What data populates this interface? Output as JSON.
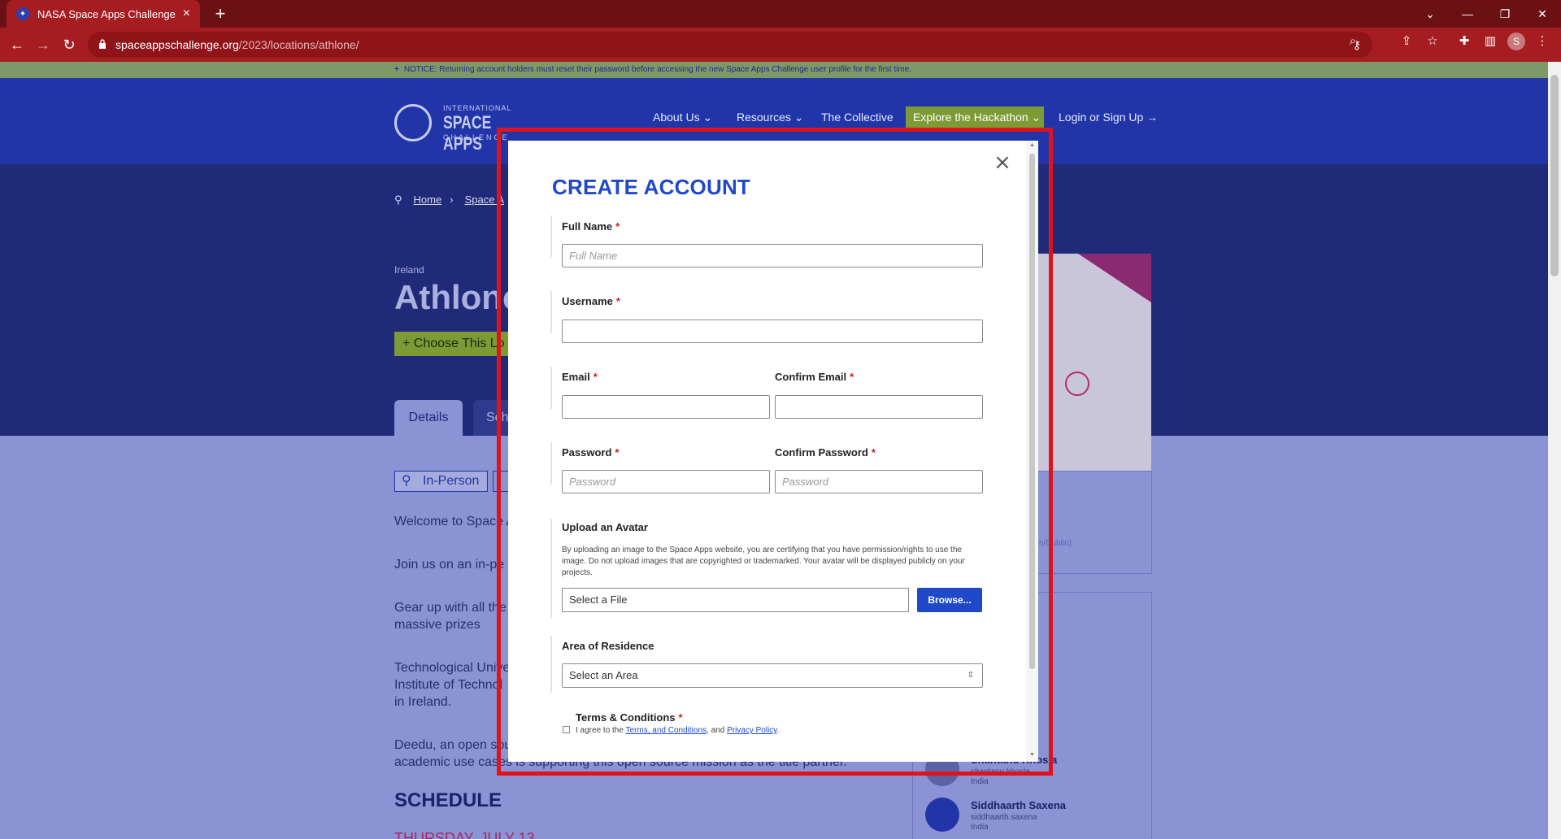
{
  "browser": {
    "tab_title": "NASA Space Apps Challenge",
    "tab_close": "×",
    "new_tab": "+",
    "url_host": "spaceappschallenge.org",
    "url_path": "/2023/locations/athlone/",
    "profile_initial": "S"
  },
  "notice": {
    "text": "NOTICE: Returning account holders must reset their password before accessing the new Space Apps Challenge user profile for the first time.",
    "plus": "+"
  },
  "logo": {
    "line1": "INTERNATIONAL",
    "line2": "SPACE APPS",
    "line3": "CHALLENGE"
  },
  "nav": {
    "about": "About Us ⌄",
    "resources": "Resources ⌄",
    "collective": "The Collective",
    "explore": "Explore the Hackathon ⌄",
    "login": "Login or Sign Up →"
  },
  "hero": {
    "breadcrumb_home": "Home",
    "breadcrumb_sep": "›",
    "breadcrumb_next": "Space A",
    "country": "Ireland",
    "city": "Athlone",
    "choose_button": "+ Choose This Lo",
    "tab_details": "Details",
    "tab_schedule": "Sch"
  },
  "content": {
    "tag_in_person": "In-Person",
    "p1": "Welcome to Space A",
    "p2": "Join us on an in-pe",
    "p3_l1": "Gear up with all the",
    "p3_l2": "massive prizes",
    "p4_l1": "Technological Unive",
    "p4_l2": "Institute of Technol",
    "p4_l3": "in Ireland.",
    "p5_l1": "Deedu, an open sou",
    "p5_l2": "academic use cases is supporting this open source mission as the title partner.",
    "schedule_heading": "SCHEDULE",
    "schedule_date": "THURSDAY, JULY 13"
  },
  "sidebar": {
    "faint_text": "n/Dublin)",
    "people": [
      {
        "name": "Shantanu Khosla",
        "username": "shantanu.khosla",
        "country": "India"
      },
      {
        "name": "Siddhaarth Saxena",
        "username": "siddhaarth.saxena",
        "country": "India"
      }
    ]
  },
  "modal": {
    "title": "CREATE ACCOUNT",
    "close": "×",
    "req": "*",
    "full_name_label": "Full Name",
    "full_name_placeholder": "Full Name",
    "username_label": "Username",
    "email_label": "Email",
    "confirm_email_label": "Confirm Email",
    "password_label": "Password",
    "password_placeholder": "Password",
    "confirm_password_label": "Confirm Password",
    "confirm_password_placeholder": "Password",
    "avatar_label": "Upload an Avatar",
    "avatar_help": "By uploading an image to the Space Apps website, you are certifying that you have permission/rights to use the image. Do not upload images that are copyrighted or trademarked. Your avatar will be displayed publicly on your projects.",
    "file_placeholder": "Select a File",
    "browse_button": "Browse...",
    "area_label": "Area of Residence",
    "area_select": "Select an Area",
    "terms_label": "Terms & Conditions",
    "terms_prefix": "I agree to the ",
    "terms_link": "Terms, and Conditions",
    "terms_mid": ", and ",
    "privacy_link": "Privacy Policy",
    "terms_end": "."
  },
  "colors": {
    "brand_blue": "#2135a8",
    "modal_accent": "#1f49c8",
    "highlight_red": "#e0121b",
    "explore_green": "#7d9b35"
  }
}
